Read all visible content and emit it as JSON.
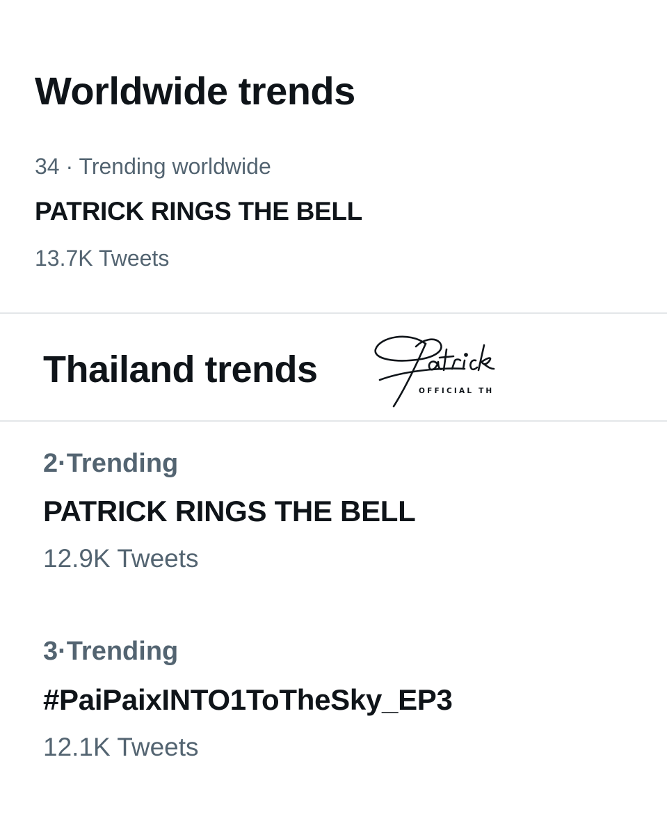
{
  "worldwide": {
    "title": "Worldwide trends",
    "trend": {
      "rank": "34",
      "separator": "·",
      "context": "Trending worldwide",
      "name": "PATRICK RINGS THE BELL",
      "tweets": "13.7K Tweets"
    }
  },
  "thailand": {
    "title": "Thailand trends",
    "trends": [
      {
        "rank": "2",
        "separator": "·",
        "context": "Trending",
        "name": "PATRICK RINGS THE BELL",
        "tweets": "12.9K Tweets"
      },
      {
        "rank": "3",
        "separator": "·",
        "context": "Trending",
        "name": "#PaiPaixINTO1ToTheSky_EP3",
        "tweets": "12.1K Tweets"
      }
    ]
  },
  "watermark": {
    "signature": "Patrick",
    "caption": "OFFICIAL TH"
  }
}
